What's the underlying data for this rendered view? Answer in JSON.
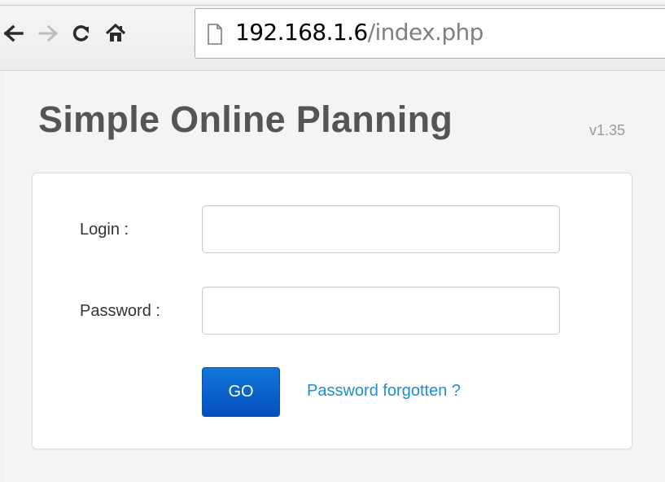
{
  "browser": {
    "back_icon": "arrow-left-icon",
    "forward_icon": "arrow-right-icon",
    "reload_icon": "reload-icon",
    "home_icon": "home-icon",
    "page_icon": "page-icon",
    "url_host": "192.168.1.6",
    "url_path": "/index.php"
  },
  "app": {
    "title": "Simple Online Planning",
    "version": "v1.35"
  },
  "login_form": {
    "login_label": "Login :",
    "login_value": "",
    "password_label": "Password :",
    "password_value": "",
    "submit_label": "GO",
    "forgot_link": "Password forgotten ?"
  },
  "colors": {
    "title": "#555555",
    "button": "#0a5fcf",
    "link": "#1a8fd8"
  }
}
